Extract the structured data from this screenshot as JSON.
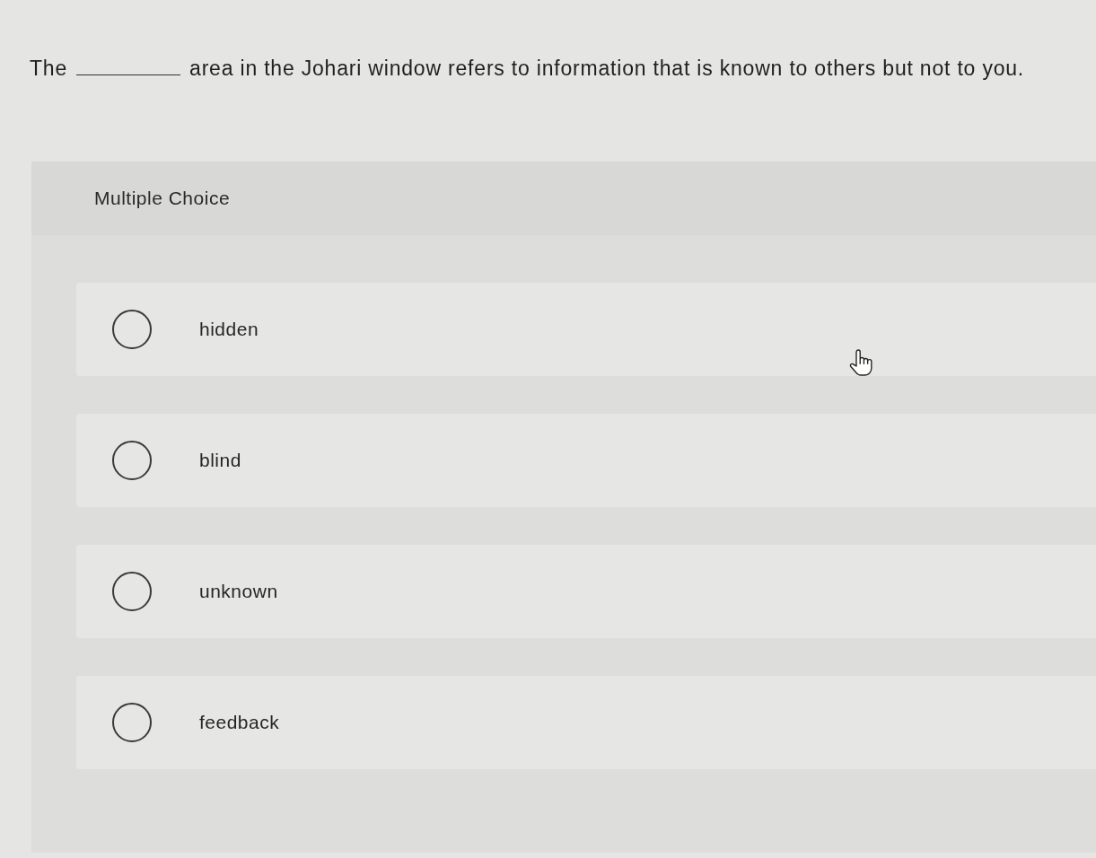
{
  "question": {
    "text_before": "The",
    "text_after": "area in the Johari window refers to information that is known to others but not to you."
  },
  "section_title": "Multiple Choice",
  "options": [
    {
      "label": "hidden",
      "selected": false
    },
    {
      "label": "blind",
      "selected": false
    },
    {
      "label": "unknown",
      "selected": false
    },
    {
      "label": "feedback",
      "selected": false
    }
  ]
}
